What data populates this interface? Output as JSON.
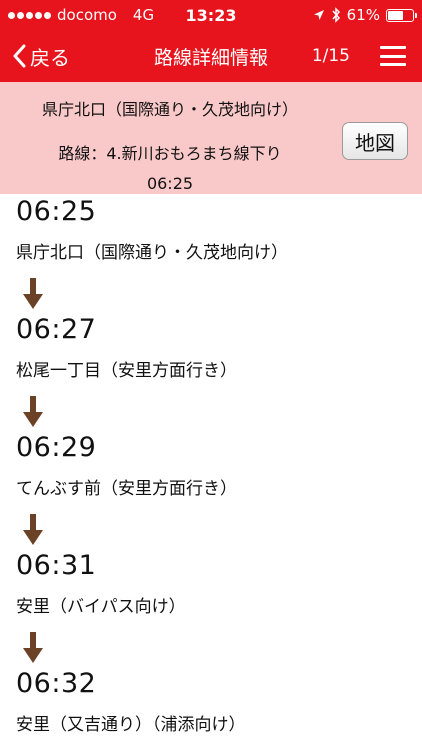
{
  "status_bar": {
    "carrier": "docomo",
    "network": "4G",
    "time": "13:23",
    "battery_percent": "61%",
    "battery_level": 0.61
  },
  "nav": {
    "back_label": "戻る",
    "title": "路線詳細情報",
    "page_count": "1/15"
  },
  "info": {
    "stop_name": "県庁北口（国際通り・久茂地向け）",
    "route": "路線：4.新川おもろまち線下り",
    "departure_time": "06:25",
    "map_button": "地図"
  },
  "stops": [
    {
      "time": "06:25",
      "name": "県庁北口（国際通り・久茂地向け）"
    },
    {
      "time": "06:27",
      "name": "松尾一丁目（安里方面行き）"
    },
    {
      "time": "06:29",
      "name": "てんぶす前（安里方面行き）"
    },
    {
      "time": "06:31",
      "name": "安里（バイパス向け）"
    },
    {
      "time": "06:32",
      "name": "安里（又吉通り）（浦添向け）"
    }
  ],
  "colors": {
    "header_red": "#e8141d",
    "info_bg": "#f9c9c9",
    "arrow_brown": "#6b4226"
  }
}
